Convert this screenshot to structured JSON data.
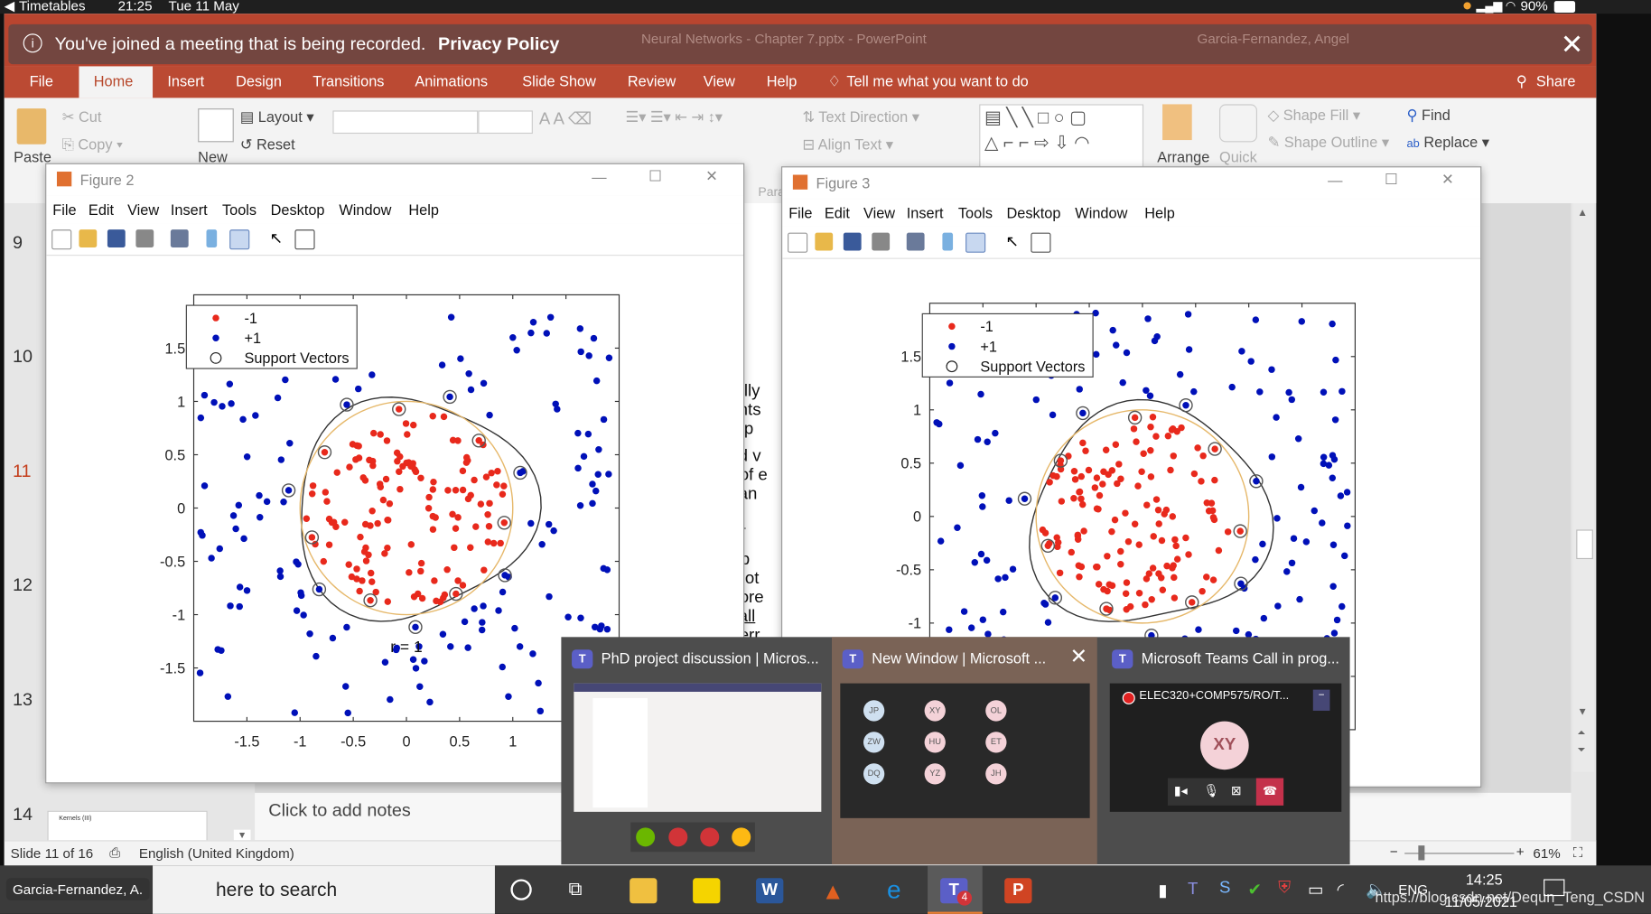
{
  "status_bar": {
    "back_label": "Timetables",
    "time": "21:25",
    "date": "Tue 11 May",
    "battery": "90%"
  },
  "notification": {
    "text": "You've joined a meeting that is being recorded.",
    "link": "Privacy Policy"
  },
  "ppt": {
    "title": "Neural Networks - Chapter 7.pptx  -  PowerPoint",
    "user": "Garcia-Fernandez, Angel",
    "tabs": [
      "File",
      "Home",
      "Insert",
      "Design",
      "Transitions",
      "Animations",
      "Slide Show",
      "Review",
      "View",
      "Help"
    ],
    "active_tab": "Home",
    "tell_me": "Tell me what you want to do",
    "share": "Share",
    "ribbon": {
      "paste": "Paste",
      "cut": "Cut",
      "copy": "Copy",
      "new": "New",
      "layout": "Layout",
      "reset": "Reset",
      "text_direction": "Text Direction",
      "align_text": "Align Text",
      "arrange": "Arrange",
      "quick": "Quick",
      "shape_fill": "Shape Fill",
      "shape_outline": "Shape Outline",
      "find": "Find",
      "replace": "Replace",
      "para": "Para"
    },
    "slide_numbers": [
      "9",
      "10",
      "11",
      "12",
      "13",
      "14"
    ],
    "current_slide": "11",
    "thumb_14_title": "Kernels (III)",
    "slide_text": {
      "title_frag": "le",
      "lines": [
        "deally",
        "points",
        "r hyp",
        "died v",
        "on of e",
        "e can",
        "≥1−",
        "prob",
        "er not",
        "before",
        "small",
        "on err"
      ]
    },
    "notes_placeholder": "Click to add notes",
    "status": {
      "slide": "Slide 11 of 16",
      "language": "English (United Kingdom)",
      "zoom": "61%"
    }
  },
  "figures": [
    {
      "title": "Figure 2",
      "menu": [
        "File",
        "Edit",
        "View",
        "Insert",
        "Tools",
        "Desktop",
        "Window",
        "Help"
      ],
      "legend": [
        "-1",
        "+1",
        "Support Vectors"
      ],
      "xticks": [
        "-1.5",
        "-1",
        "-0.5",
        "0",
        "0.5",
        "1"
      ],
      "yticks": [
        "1.5",
        "1",
        "0.5",
        "0",
        "-0.5",
        "-1",
        "-1.5"
      ],
      "annotation": "r = 1"
    },
    {
      "title": "Figure 3",
      "menu": [
        "File",
        "Edit",
        "View",
        "Insert",
        "Tools",
        "Desktop",
        "Window",
        "Help"
      ],
      "legend": [
        "-1",
        "+1",
        "Support Vectors"
      ],
      "yticks": [
        "1.5",
        "1",
        "0.5",
        "0",
        "-0.5",
        "-1"
      ]
    }
  ],
  "chart_data": [
    {
      "type": "scatter",
      "title": "",
      "xlim": [
        -2,
        2
      ],
      "ylim": [
        -2,
        2
      ],
      "series": [
        {
          "name": "-1",
          "color": "#e8291c"
        },
        {
          "name": "+1",
          "color": "#0010b8"
        },
        {
          "name": "Support Vectors"
        }
      ],
      "legend": "top-left",
      "annotation": "r = 1"
    },
    {
      "type": "scatter",
      "title": "",
      "xlim": [
        -2,
        2
      ],
      "ylim": [
        -2,
        2
      ],
      "series": [
        {
          "name": "-1",
          "color": "#e8291c"
        },
        {
          "name": "+1",
          "color": "#0010b8"
        },
        {
          "name": "Support Vectors"
        }
      ],
      "legend": "top-left"
    }
  ],
  "teams": {
    "tiles": [
      {
        "title": "PhD project discussion | Micros..."
      },
      {
        "title": "New Window | Microsoft ..."
      },
      {
        "title": "Microsoft Teams Call in prog..."
      }
    ],
    "call_name": "ELEC320+COMP575/RO/T...",
    "call_avatar": "XY",
    "grid": [
      "JP",
      "XY",
      "OL",
      "ZW",
      "HU",
      "ET",
      "DQ",
      "YZ",
      "JH"
    ]
  },
  "taskbar": {
    "search": "here to search",
    "tooltip": "Garcia-Fernandez, A.",
    "lang": "ENG",
    "time": "14:25",
    "date": "11/05/2021",
    "teams_badge": "4",
    "watermark": "https://blog.csdn.net/Dequn_Teng_CSDN"
  },
  "colors": {
    "ppt_red": "#b9452f",
    "red_class": "#e8291c",
    "blue_class": "#0010b8"
  }
}
